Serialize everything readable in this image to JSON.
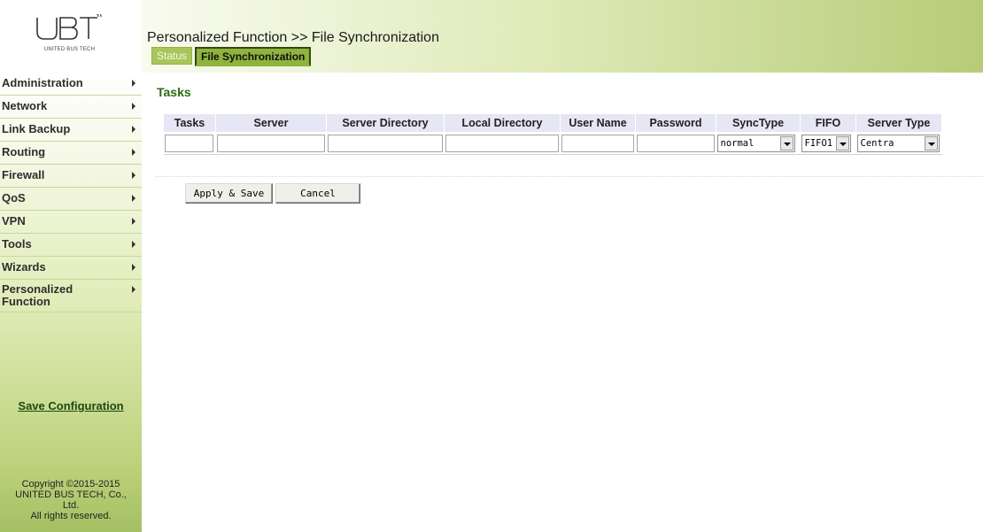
{
  "brand": {
    "logo_text": "UBT",
    "subtitle": "UNITED BUS TECH"
  },
  "header": {
    "breadcrumb": "Personalized Function >> File Synchronization",
    "tabs": [
      {
        "label": "Status",
        "active": false
      },
      {
        "label": "File Synchronization",
        "active": true
      }
    ]
  },
  "sidebar": {
    "items": [
      {
        "label": "Administration"
      },
      {
        "label": "Network"
      },
      {
        "label": "Link Backup"
      },
      {
        "label": "Routing"
      },
      {
        "label": "Firewall"
      },
      {
        "label": "QoS"
      },
      {
        "label": "VPN"
      },
      {
        "label": "Tools"
      },
      {
        "label": "Wizards"
      },
      {
        "label": "Personalized Function"
      }
    ],
    "save_configuration": "Save Configuration",
    "copyright": {
      "line1": "Copyright ©2015-2015",
      "line2": "UNITED BUS TECH, Co.,",
      "line3": "Ltd.",
      "line4": "All rights reserved."
    }
  },
  "main": {
    "section_title": "Tasks",
    "table": {
      "headers": [
        "Tasks",
        "Server",
        "Server Directory",
        "Local Directory",
        "User Name",
        "Password",
        "SyncType",
        "FIFO",
        "Server Type"
      ],
      "row": {
        "tasks": "",
        "server": "",
        "server_directory": "",
        "local_directory": "",
        "user_name": "",
        "password": "",
        "sync_type": "normal",
        "fifo": "FIFO1",
        "server_type": "Centra"
      }
    },
    "buttons": {
      "apply_save": "Apply & Save",
      "cancel": "Cancel"
    }
  },
  "colors": {
    "accent_green": "#8fb33c",
    "title_green": "#2c6b12",
    "table_header_bg": "#e6e6f5"
  }
}
